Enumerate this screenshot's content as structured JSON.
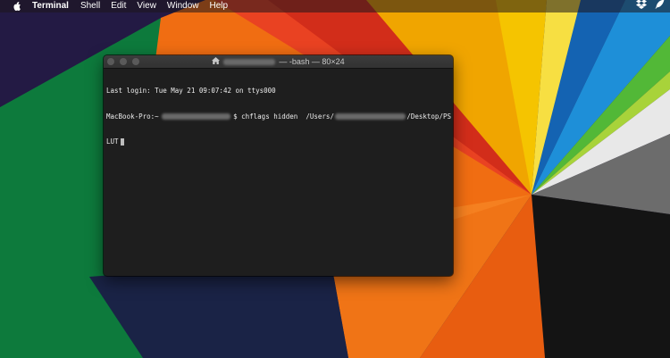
{
  "menubar": {
    "apple_icon": "apple-logo-icon",
    "app_name": "Terminal",
    "items": [
      "Shell",
      "Edit",
      "View",
      "Window",
      "Help"
    ],
    "right_icons": [
      "dropbox-icon",
      "feather-icon"
    ]
  },
  "window": {
    "title_suffix": "— -bash — 80×24",
    "home_icon": "home-icon",
    "lines": {
      "login": "Last login: Tue May 21 09:07:42 on ttys000",
      "prompt_host": "MacBook-Pro:~",
      "command": "$ chflags hidden  /Users/",
      "path_suffix": "/Desktop/PS",
      "continuation": "LUT"
    }
  },
  "colors": {
    "terminal_bg": "#1e1e1e",
    "terminal_text": "#ececec",
    "titlebar": "#3a3a3a"
  }
}
